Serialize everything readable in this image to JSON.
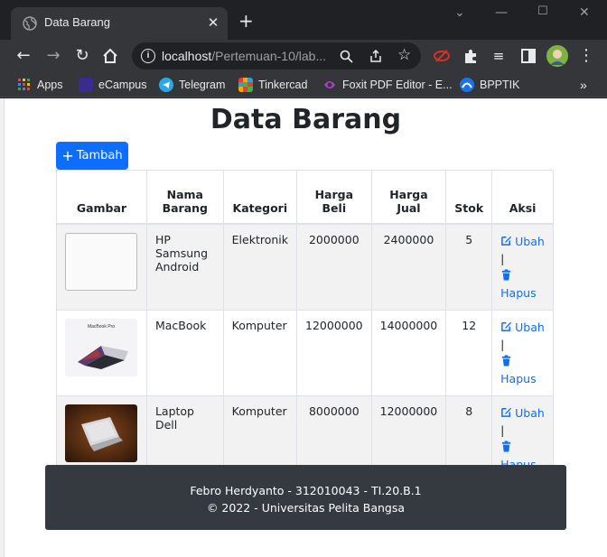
{
  "browser": {
    "tab_title": "Data Barang",
    "url_host": "localhost",
    "url_path": "/Pertemuan-10/lab...",
    "bookmarks": [
      "Apps",
      "eCampus",
      "Telegram",
      "Tinkercad",
      "Foxit PDF Editor - E...",
      "BPPTIK"
    ]
  },
  "page": {
    "title": "Data Barang",
    "add_button": "Tambah",
    "table": {
      "headers": [
        "Gambar",
        "Nama\nBarang",
        "Kategori",
        "Harga\nBeli",
        "Harga\nJual",
        "Stok",
        "Aksi"
      ],
      "rows": [
        {
          "nama": "HP Samsung Android",
          "kategori": "Elektronik",
          "harga_beli": "2000000",
          "harga_jual": "2400000",
          "stok": "5",
          "image": "broken-image"
        },
        {
          "nama": "MacBook",
          "kategori": "Komputer",
          "harga_beli": "12000000",
          "harga_jual": "14000000",
          "stok": "12",
          "image": "macbook-photo",
          "image_caption": "MacBook Pro"
        },
        {
          "nama": "Laptop Dell",
          "kategori": "Komputer",
          "harga_beli": "8000000",
          "harga_jual": "12000000",
          "stok": "8",
          "image": "laptop-dell-photo"
        }
      ],
      "edit_label": "Ubah",
      "separator": "|",
      "delete_label": "Hapus"
    },
    "footer": {
      "line1": "Febro Herdyanto - 312010043 - TI.20.B.1",
      "line2": "© 2022 - Universitas Pelita Bangsa"
    }
  },
  "colors": {
    "primary": "#0d6efd",
    "footer_bg": "#343a40",
    "chrome_dark": "#202124"
  }
}
